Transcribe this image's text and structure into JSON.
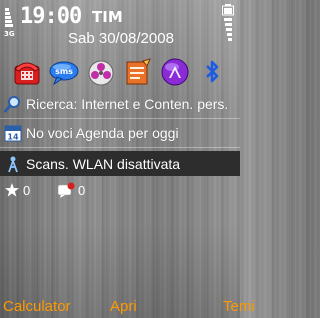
{
  "status": {
    "network_type": "3G",
    "time": "19:00",
    "operator": "TIM",
    "date": "Sab 30/08/2008"
  },
  "shortcuts": [
    {
      "name": "phone-icon",
      "color": "#d81e1e"
    },
    {
      "name": "sms-icon",
      "label": "sms",
      "color": "#1e6fd8"
    },
    {
      "name": "media-icon",
      "color": "#c22ea8"
    },
    {
      "name": "notes-icon",
      "color": "#e8722a"
    },
    {
      "name": "browser-icon",
      "color": "#8a2bd6"
    },
    {
      "name": "bluetooth-icon",
      "color": "#1e5be0"
    }
  ],
  "rows": {
    "search": {
      "text": "Ricerca: Internet e Conten. pers.",
      "icon": "magnifier-icon"
    },
    "agenda": {
      "text": "No voci Agenda per oggi",
      "icon": "calendar-icon",
      "day": "14"
    },
    "wlan": {
      "text": "Scans. WLAN disattivata",
      "icon": "wlan-icon"
    }
  },
  "counters": {
    "missed_events": "0",
    "messages": "0"
  },
  "softkeys": {
    "left": "Calculator",
    "middle": "Apri",
    "right": "Temi"
  },
  "colors": {
    "softkey": "#ff9900",
    "text": "#ffffff",
    "highlight": "#2d2d2d"
  }
}
